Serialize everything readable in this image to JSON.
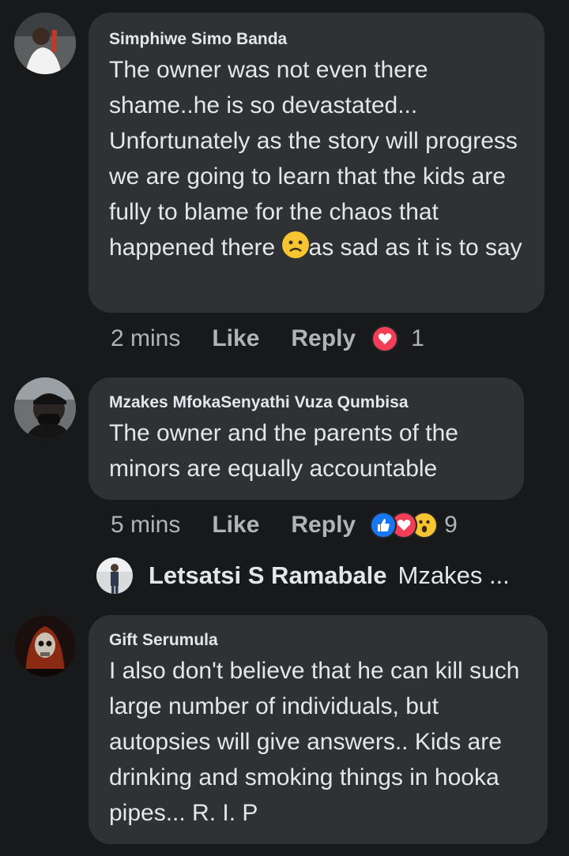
{
  "comments": [
    {
      "author": "Simphiwe Simo Banda",
      "text_before_emoji": "The owner was not even there shame..he is so devastated... Unfortunately as the story will progress we are going to learn that the kids are fully to blame for the chaos that happened there ",
      "text_after_emoji": "as sad as it is to say",
      "time": "2 mins",
      "like_label": "Like",
      "reply_label": "Reply",
      "reaction_count": "1",
      "reactions": [
        "love-reaction-icon"
      ]
    },
    {
      "author": "Mzakes MfokaSenyathi Vuza Qumbisa",
      "text": "The owner and the parents of the minors are equally accountable",
      "time": "5 mins",
      "like_label": "Like",
      "reply_label": "Reply",
      "reaction_count": "9",
      "reactions": [
        "like-reaction-icon",
        "love-reaction-icon",
        "wow-reaction-icon"
      ]
    },
    {
      "author": "Gift Serumula",
      "text": "I also don't believe that he can kill such large number of individuals, but autopsies will give answers.. Kids are drinking and smoking things in hooka pipes... R. I. P"
    }
  ],
  "reply_preview": {
    "author": "Letsatsi S Ramabale",
    "text": "Mzakes ..."
  },
  "colors": {
    "background": "#18191a",
    "bubble": "#303133",
    "text": "#e4e6eb",
    "secondary_text": "#b0b3b8",
    "like_blue": "#1877f2",
    "love_red": "#f33e58",
    "emoji_yellow": "#f7c531"
  }
}
